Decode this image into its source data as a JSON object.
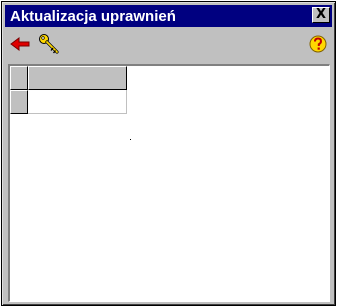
{
  "window": {
    "title": "Aktualizacja uprawnień",
    "close_label": "X"
  },
  "toolbar": {
    "buttons": [
      {
        "icon": "back-arrow-icon",
        "color": "#e00000"
      },
      {
        "icon": "key-icon",
        "color": "#ffd800"
      },
      {
        "icon": "help-icon",
        "color": "#ffd800"
      }
    ]
  },
  "grid": {
    "columns": [
      ""
    ],
    "rows": [
      [
        ""
      ]
    ]
  },
  "colors": {
    "titlebar": "#000080",
    "face": "#c0c0c0"
  }
}
